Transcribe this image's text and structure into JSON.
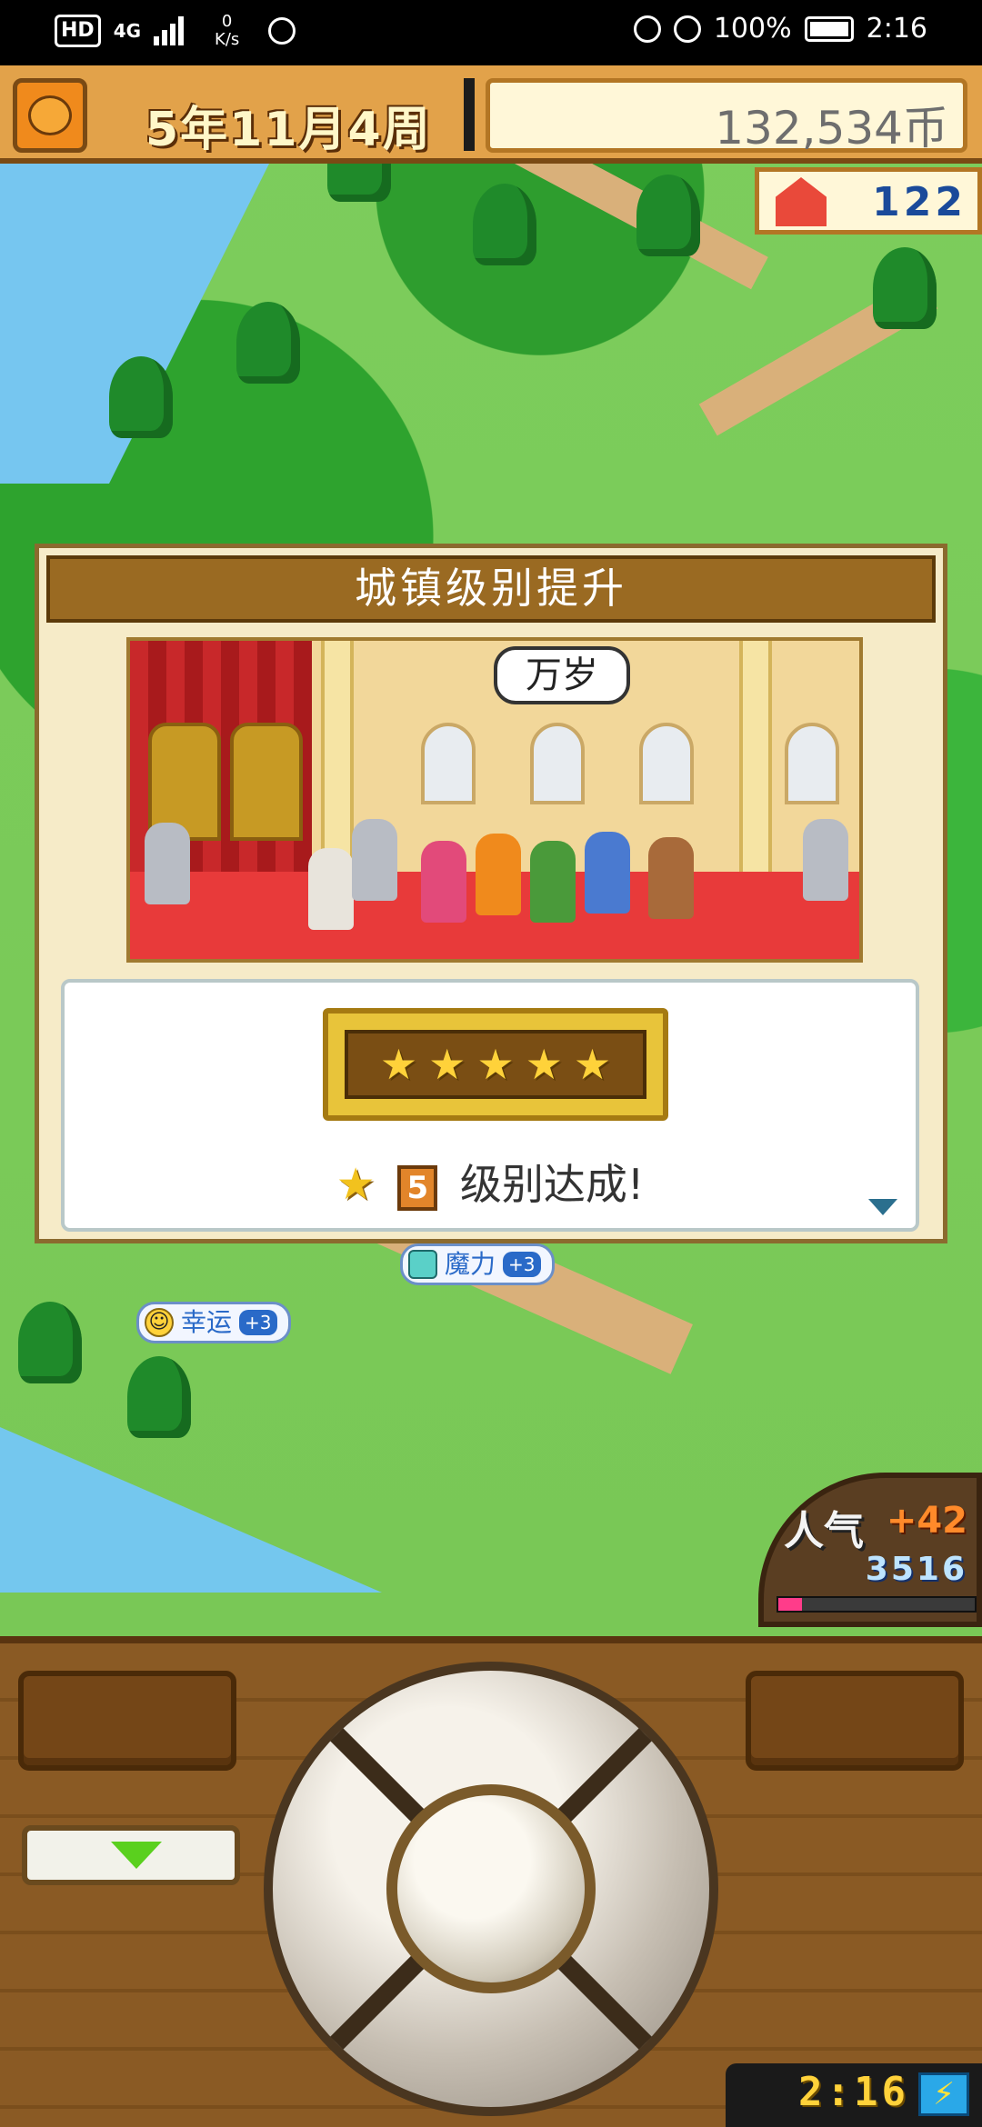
{
  "status_bar": {
    "hd": "HD",
    "network": "4G",
    "speed_value": "0",
    "speed_unit": "K/s",
    "battery_percent": "100%",
    "time": "2:16"
  },
  "hud": {
    "date": "5年11月4周",
    "coins": "132,534币",
    "houses": "122"
  },
  "dialog": {
    "title": "城镇级别提升",
    "speech_bubble": "万岁",
    "stars": [
      "★",
      "★",
      "★",
      "★",
      "★"
    ],
    "level": "5",
    "level_message": "级别达成!"
  },
  "world_tags": {
    "magic": {
      "label": "魔力",
      "bonus": "+3"
    },
    "luck": {
      "label": "幸运",
      "bonus": "+3"
    }
  },
  "popularity": {
    "label": "人气",
    "delta": "+42",
    "value": "3516",
    "bar_fill_fraction": 0.12
  },
  "game_clock": {
    "time": "2:16"
  },
  "colors": {
    "hud_orange": "#e2a24a",
    "title_brown": "#9a6a22",
    "star_gold": "#ffd23a"
  }
}
